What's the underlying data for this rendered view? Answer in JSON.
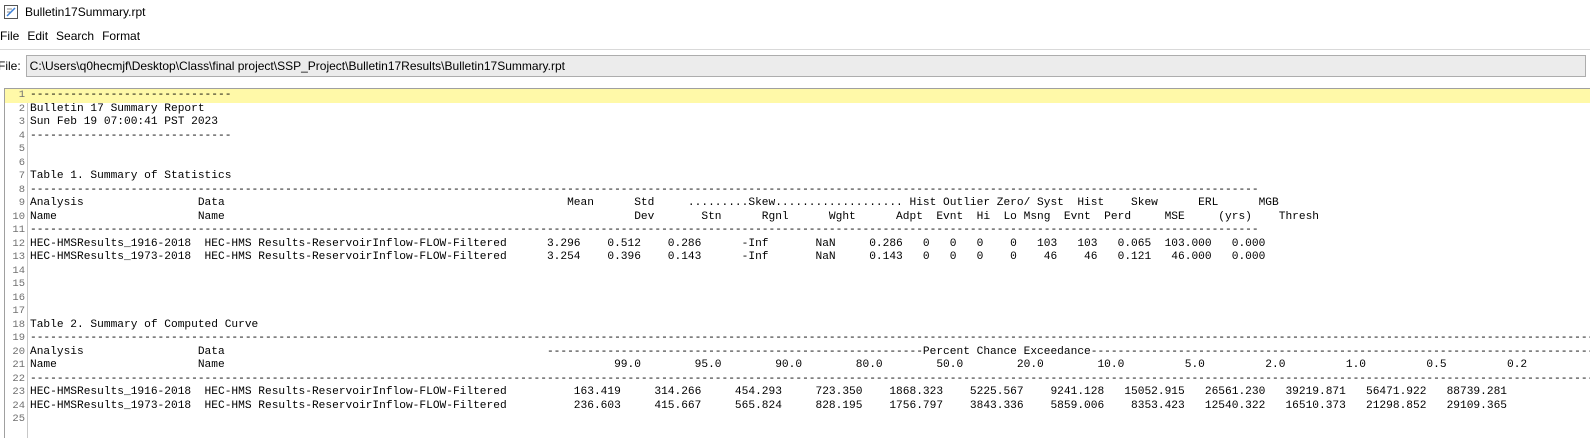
{
  "window": {
    "title": "Bulletin17Summary.rpt",
    "icon": "notepad-document-icon"
  },
  "menu": [
    {
      "label": "File"
    },
    {
      "label": "Edit"
    },
    {
      "label": "Search"
    },
    {
      "label": "Format"
    }
  ],
  "file_bar": {
    "label": "File:",
    "path": "C:\\Users\\q0hecmjf\\Desktop\\Class\\final project\\SSP_Project\\Bulletin17Results\\Bulletin17Summary.rpt"
  },
  "editor": {
    "current_line": 1,
    "lines": [
      {
        "n": "1",
        "text": "------------------------------"
      },
      {
        "n": "2",
        "text": "Bulletin 17 Summary Report"
      },
      {
        "n": "3",
        "text": "Sun Feb 19 07:00:41 PST 2023"
      },
      {
        "n": "4",
        "text": "------------------------------"
      },
      {
        "n": "5",
        "text": ""
      },
      {
        "n": "6",
        "text": ""
      },
      {
        "n": "7",
        "text": "Table 1. Summary of Statistics"
      },
      {
        "n": "8",
        "text": "---------------------------------------------------------------------------------------------------------------------------------------------------------------------------------------"
      },
      {
        "n": "9",
        "text": "Analysis                 Data                                                   Mean      Std     .........Skew................... Hist Outlier Zero/ Syst  Hist    Skew      ERL      MGB"
      },
      {
        "n": "10",
        "text": "Name                     Name                                                             Dev       Stn      Rgnl      Wght      Adpt  Evnt  Hi  Lo Msng  Evnt  Perd     MSE     (yrs)    Thresh"
      },
      {
        "n": "11",
        "text": "---------------------------------------------------------------------------------------------------------------------------------------------------------------------------------------"
      },
      {
        "n": "12",
        "text": "HEC-HMSResults_1916-2018  HEC-HMS Results-ReservoirInflow-FLOW-Filtered      3.296    0.512    0.286      -Inf       NaN     0.286   0   0   0    0   103   103   0.065  103.000   0.000"
      },
      {
        "n": "13",
        "text": "HEC-HMSResults_1973-2018  HEC-HMS Results-ReservoirInflow-FLOW-Filtered      3.254    0.396    0.143      -Inf       NaN     0.143   0   0   0    0    46    46   0.121   46.000   0.000"
      },
      {
        "n": "14",
        "text": ""
      },
      {
        "n": "15",
        "text": ""
      },
      {
        "n": "16",
        "text": ""
      },
      {
        "n": "17",
        "text": ""
      },
      {
        "n": "18",
        "text": "Table 2. Summary of Computed Curve"
      },
      {
        "n": "19",
        "text": "-------------------------------------------------------------------------------------------------------------------------------------------------------------------------------------------------------------------------------------------------"
      },
      {
        "n": "20",
        "text": "Analysis                 Data                                                --------------------------------------------------------Percent Chance Exceedance-------------------------------------------------------------------------------------"
      },
      {
        "n": "21",
        "text": "Name                     Name                                                          99.0        95.0        90.0        80.0        50.0        20.0        10.0         5.0         2.0         1.0         0.5         0.2"
      },
      {
        "n": "22",
        "text": "-------------------------------------------------------------------------------------------------------------------------------------------------------------------------------------------------------------------------------------------------"
      },
      {
        "n": "23",
        "text": "HEC-HMSResults_1916-2018  HEC-HMS Results-ReservoirInflow-FLOW-Filtered          163.419     314.266     454.293     723.350    1868.323    5225.567    9241.128   15052.915   26561.230   39219.871   56471.922   88739.281"
      },
      {
        "n": "24",
        "text": "HEC-HMSResults_1973-2018  HEC-HMS Results-ReservoirInflow-FLOW-Filtered          236.603     415.667     565.824     828.195    1756.797    3843.336    5859.006    8353.423   12540.322   16510.373   21298.852   29109.365"
      },
      {
        "n": "25",
        "text": ""
      }
    ]
  }
}
